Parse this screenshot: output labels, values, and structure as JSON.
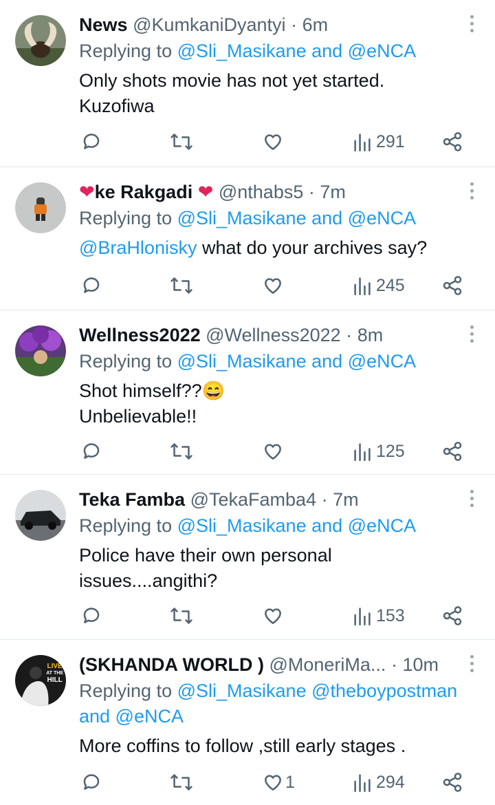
{
  "tweets": [
    {
      "name": "News",
      "handle": "@KumkaniDyantyi",
      "dot": "·",
      "time": "6m",
      "reply_prefix": "Replying to",
      "reply_to": "@Sli_Masikane and @eNCA",
      "mention": "",
      "lines": [
        "Only shots movie has not yet started.",
        "Kuzofiwa"
      ],
      "replies": "",
      "retweets": "",
      "likes": "",
      "views": "291",
      "avatar": "antelope-horns"
    },
    {
      "name": "ke Rakgadi",
      "name_prefix_emoji": "❤",
      "name_suffix_emoji": "❤",
      "handle": "@nthabs5",
      "dot": "·",
      "time": "7m",
      "reply_prefix": "Replying to",
      "reply_to": "@Sli_Masikane and @eNCA",
      "mention": "@BraHlonisky",
      "lines": [
        "what do your archives say?"
      ],
      "replies": "",
      "retweets": "",
      "likes": "",
      "views": "245",
      "avatar": "child-figure"
    },
    {
      "name": "Wellness2022",
      "handle": "@Wellness2022",
      "dot": "·",
      "time": "8m",
      "reply_prefix": "Replying to",
      "reply_to": "@Sli_Masikane and @eNCA",
      "mention": "",
      "lines": [
        "Shot himself??😄",
        "Unbelievable!!"
      ],
      "replies": "",
      "retweets": "",
      "likes": "",
      "views": "125",
      "avatar": "purple-flowers"
    },
    {
      "name": "Teka Famba",
      "handle": "@TekaFamba4",
      "dot": "·",
      "time": "7m",
      "reply_prefix": "Replying to",
      "reply_to": "@Sli_Masikane and @eNCA",
      "mention": "",
      "lines": [
        "Police have their own personal",
        "issues....angithi?"
      ],
      "replies": "",
      "retweets": "",
      "likes": "",
      "views": "153",
      "avatar": "black-car"
    },
    {
      "name": "(SKHANDA WORLD )",
      "handle": "@MoneriMa...",
      "dot": "·",
      "time": "10m",
      "reply_prefix": "Replying to",
      "reply_to": "@Sli_Masikane @theboypostman",
      "reply_to_2": "and @eNCA",
      "mention": "",
      "lines": [
        "More coffins to follow ,still early stages ."
      ],
      "replies": "",
      "retweets": "",
      "likes": "1",
      "views": "294",
      "avatar": "live-at-the-hill",
      "avatar_text": [
        "LIVE",
        "AT THE",
        "HILL"
      ]
    }
  ],
  "colors": {
    "text": "#0f1419",
    "secondary": "#536471",
    "link": "#1d9bf0",
    "heart": "#e0245e",
    "divider": "#e1e6ea"
  },
  "icons": [
    "reply-icon",
    "retweet-icon",
    "like-icon",
    "views-icon",
    "share-icon",
    "more-icon"
  ]
}
